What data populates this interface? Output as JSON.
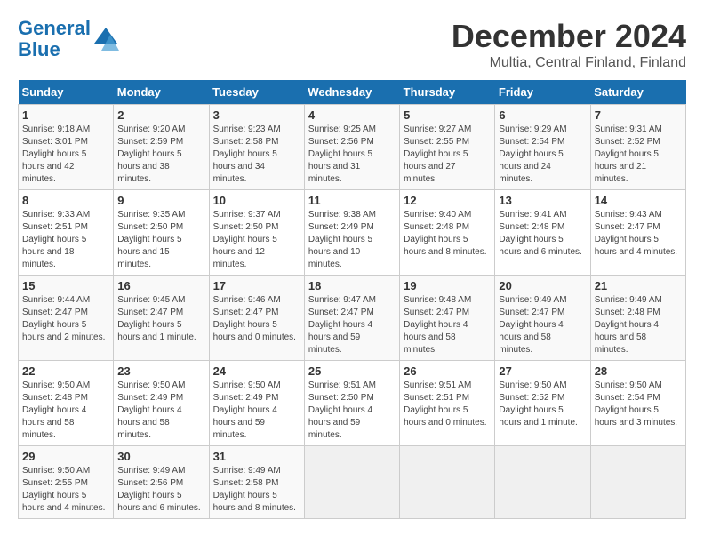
{
  "header": {
    "logo_line1": "General",
    "logo_line2": "Blue",
    "month": "December 2024",
    "location": "Multia, Central Finland, Finland"
  },
  "weekdays": [
    "Sunday",
    "Monday",
    "Tuesday",
    "Wednesday",
    "Thursday",
    "Friday",
    "Saturday"
  ],
  "weeks": [
    [
      {
        "day": "1",
        "sunrise": "9:18 AM",
        "sunset": "3:01 PM",
        "daylight": "5 hours and 42 minutes."
      },
      {
        "day": "2",
        "sunrise": "9:20 AM",
        "sunset": "2:59 PM",
        "daylight": "5 hours and 38 minutes."
      },
      {
        "day": "3",
        "sunrise": "9:23 AM",
        "sunset": "2:58 PM",
        "daylight": "5 hours and 34 minutes."
      },
      {
        "day": "4",
        "sunrise": "9:25 AM",
        "sunset": "2:56 PM",
        "daylight": "5 hours and 31 minutes."
      },
      {
        "day": "5",
        "sunrise": "9:27 AM",
        "sunset": "2:55 PM",
        "daylight": "5 hours and 27 minutes."
      },
      {
        "day": "6",
        "sunrise": "9:29 AM",
        "sunset": "2:54 PM",
        "daylight": "5 hours and 24 minutes."
      },
      {
        "day": "7",
        "sunrise": "9:31 AM",
        "sunset": "2:52 PM",
        "daylight": "5 hours and 21 minutes."
      }
    ],
    [
      {
        "day": "8",
        "sunrise": "9:33 AM",
        "sunset": "2:51 PM",
        "daylight": "5 hours and 18 minutes."
      },
      {
        "day": "9",
        "sunrise": "9:35 AM",
        "sunset": "2:50 PM",
        "daylight": "5 hours and 15 minutes."
      },
      {
        "day": "10",
        "sunrise": "9:37 AM",
        "sunset": "2:50 PM",
        "daylight": "5 hours and 12 minutes."
      },
      {
        "day": "11",
        "sunrise": "9:38 AM",
        "sunset": "2:49 PM",
        "daylight": "5 hours and 10 minutes."
      },
      {
        "day": "12",
        "sunrise": "9:40 AM",
        "sunset": "2:48 PM",
        "daylight": "5 hours and 8 minutes."
      },
      {
        "day": "13",
        "sunrise": "9:41 AM",
        "sunset": "2:48 PM",
        "daylight": "5 hours and 6 minutes."
      },
      {
        "day": "14",
        "sunrise": "9:43 AM",
        "sunset": "2:47 PM",
        "daylight": "5 hours and 4 minutes."
      }
    ],
    [
      {
        "day": "15",
        "sunrise": "9:44 AM",
        "sunset": "2:47 PM",
        "daylight": "5 hours and 2 minutes."
      },
      {
        "day": "16",
        "sunrise": "9:45 AM",
        "sunset": "2:47 PM",
        "daylight": "5 hours and 1 minute."
      },
      {
        "day": "17",
        "sunrise": "9:46 AM",
        "sunset": "2:47 PM",
        "daylight": "5 hours and 0 minutes."
      },
      {
        "day": "18",
        "sunrise": "9:47 AM",
        "sunset": "2:47 PM",
        "daylight": "4 hours and 59 minutes."
      },
      {
        "day": "19",
        "sunrise": "9:48 AM",
        "sunset": "2:47 PM",
        "daylight": "4 hours and 58 minutes."
      },
      {
        "day": "20",
        "sunrise": "9:49 AM",
        "sunset": "2:47 PM",
        "daylight": "4 hours and 58 minutes."
      },
      {
        "day": "21",
        "sunrise": "9:49 AM",
        "sunset": "2:48 PM",
        "daylight": "4 hours and 58 minutes."
      }
    ],
    [
      {
        "day": "22",
        "sunrise": "9:50 AM",
        "sunset": "2:48 PM",
        "daylight": "4 hours and 58 minutes."
      },
      {
        "day": "23",
        "sunrise": "9:50 AM",
        "sunset": "2:49 PM",
        "daylight": "4 hours and 58 minutes."
      },
      {
        "day": "24",
        "sunrise": "9:50 AM",
        "sunset": "2:49 PM",
        "daylight": "4 hours and 59 minutes."
      },
      {
        "day": "25",
        "sunrise": "9:51 AM",
        "sunset": "2:50 PM",
        "daylight": "4 hours and 59 minutes."
      },
      {
        "day": "26",
        "sunrise": "9:51 AM",
        "sunset": "2:51 PM",
        "daylight": "5 hours and 0 minutes."
      },
      {
        "day": "27",
        "sunrise": "9:50 AM",
        "sunset": "2:52 PM",
        "daylight": "5 hours and 1 minute."
      },
      {
        "day": "28",
        "sunrise": "9:50 AM",
        "sunset": "2:54 PM",
        "daylight": "5 hours and 3 minutes."
      }
    ],
    [
      {
        "day": "29",
        "sunrise": "9:50 AM",
        "sunset": "2:55 PM",
        "daylight": "5 hours and 4 minutes."
      },
      {
        "day": "30",
        "sunrise": "9:49 AM",
        "sunset": "2:56 PM",
        "daylight": "5 hours and 6 minutes."
      },
      {
        "day": "31",
        "sunrise": "9:49 AM",
        "sunset": "2:58 PM",
        "daylight": "5 hours and 8 minutes."
      },
      null,
      null,
      null,
      null
    ]
  ],
  "labels": {
    "sunrise": "Sunrise:",
    "sunset": "Sunset:",
    "daylight": "Daylight:"
  }
}
